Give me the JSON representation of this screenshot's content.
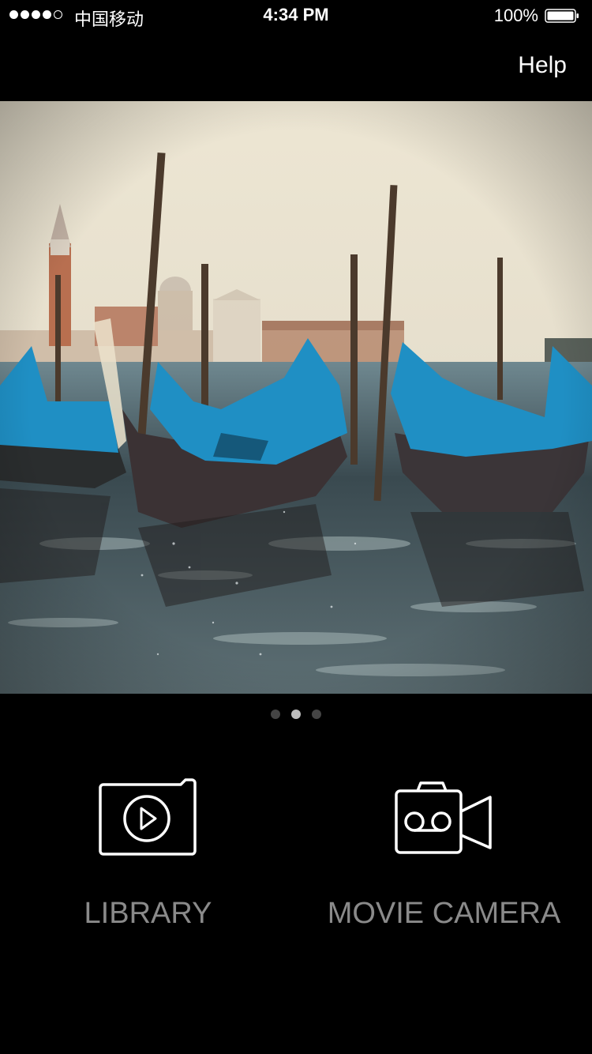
{
  "status_bar": {
    "carrier": "中国移动",
    "time": "4:34 PM",
    "battery": "100%"
  },
  "nav": {
    "help_label": "Help"
  },
  "carousel": {
    "page_count": 3,
    "active_page": 2
  },
  "actions": {
    "library_label": "LIBRARY",
    "movie_camera_label": "MOVIE CAMERA"
  },
  "colors": {
    "background": "#000000",
    "label_gray": "#8a8a8a",
    "gondola_cover": "#1f8fc4"
  },
  "icons": {
    "library": "video-library-icon",
    "camera": "movie-camera-icon"
  }
}
